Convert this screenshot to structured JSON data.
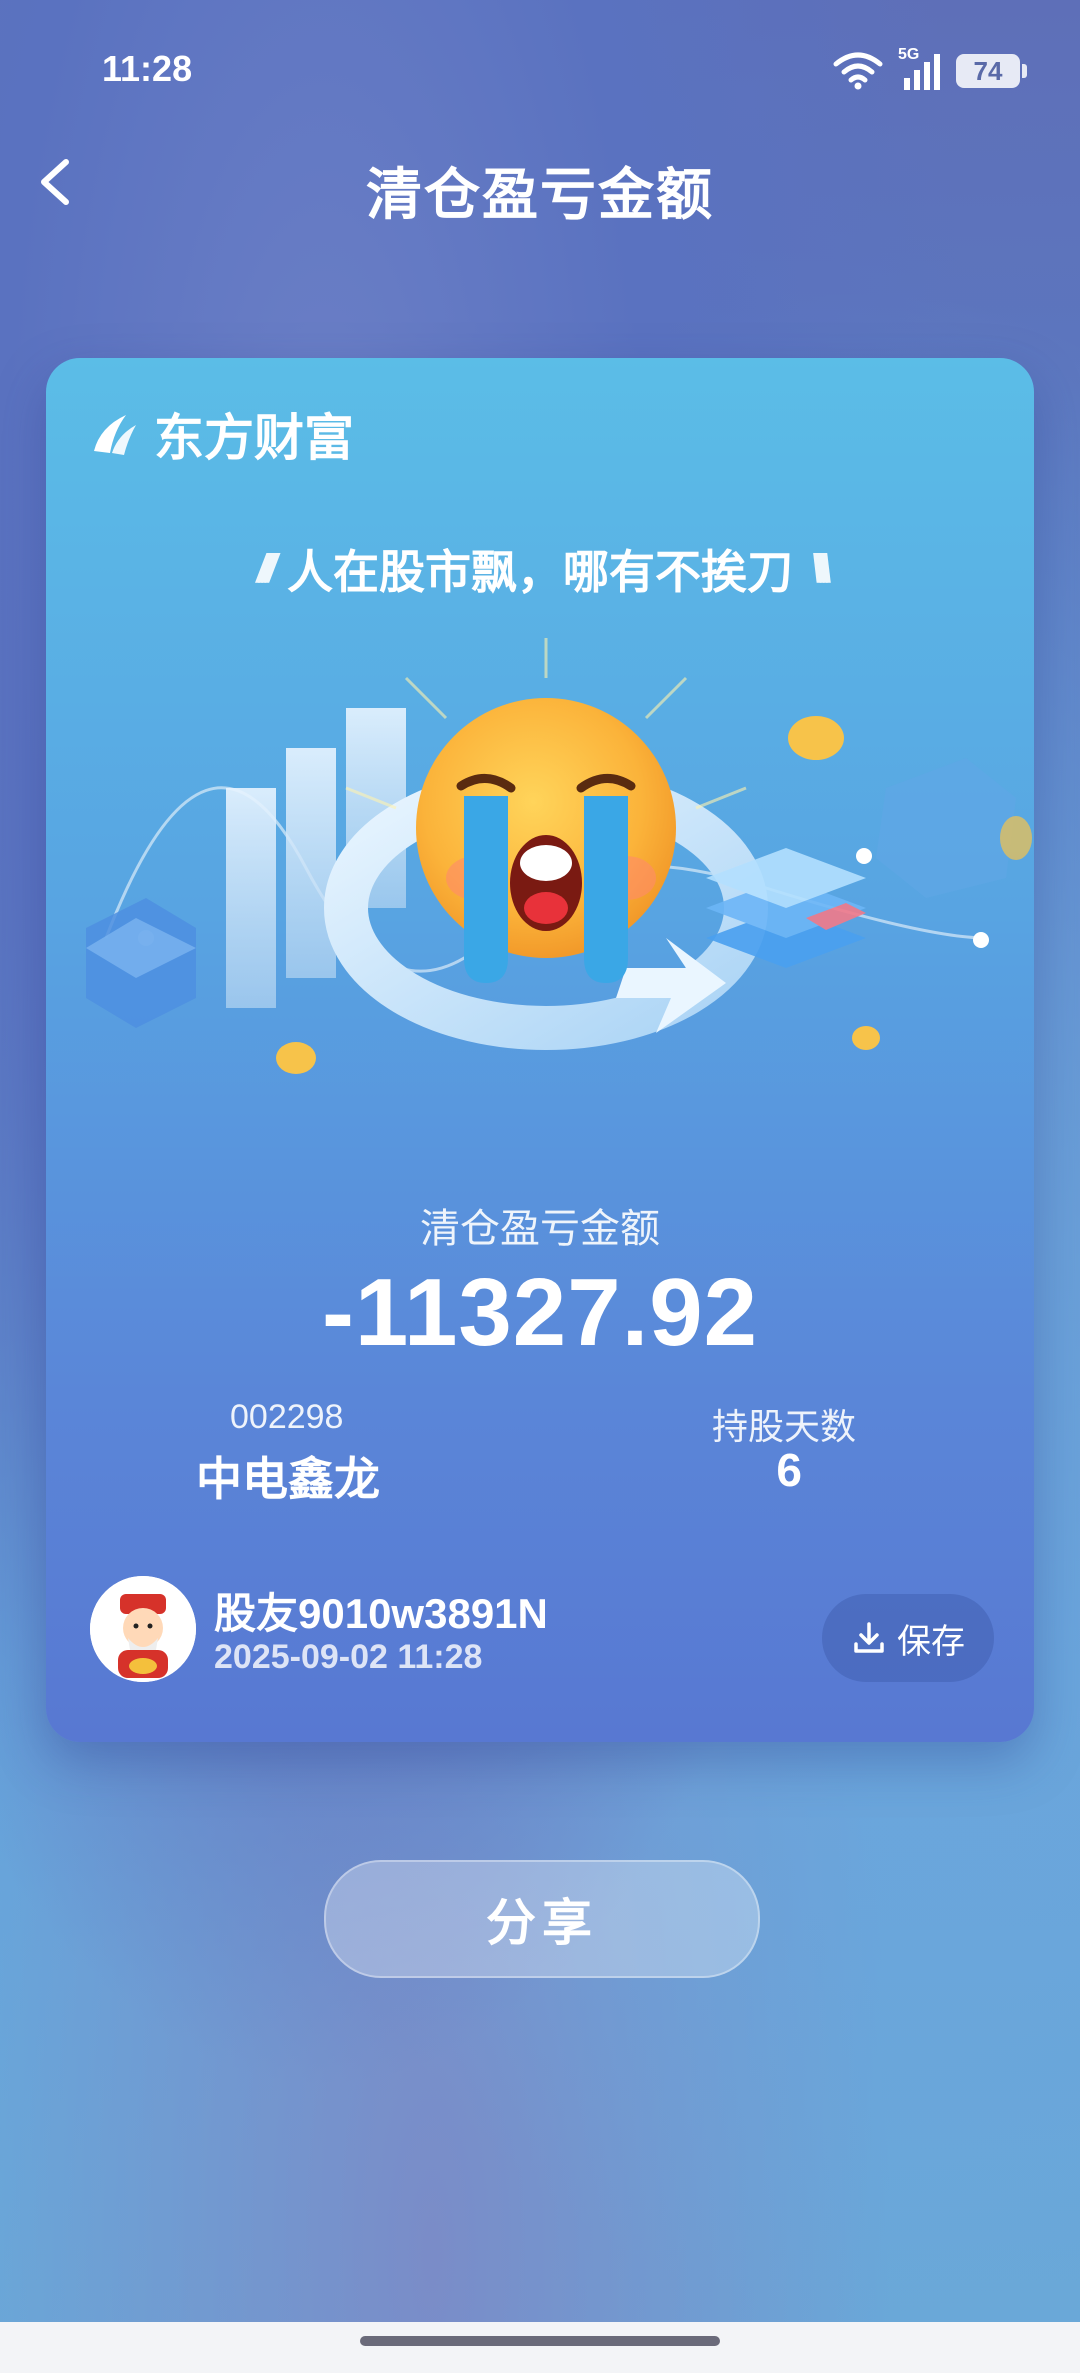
{
  "status_bar": {
    "time": "11:28",
    "network": "5G",
    "battery": "74"
  },
  "header": {
    "title": "清仓盈亏金额"
  },
  "card": {
    "brand": "东方财富",
    "slogan": "人在股市飘，哪有不挨刀",
    "amount_label": "清仓盈亏金额",
    "amount": "-11327.92",
    "stock_code": "002298",
    "stock_name": "中电鑫龙",
    "days_label": "持股天数",
    "days_value": "6",
    "user_name": "股友9010w3891N",
    "user_time": "2025-09-02 11:28",
    "save_label": "保存"
  },
  "share_label": "分享",
  "icons": [
    "back-arrow-icon",
    "wifi-icon",
    "signal-icon",
    "battery-icon",
    "brand-logo-icon",
    "crying-emoji-icon",
    "download-icon"
  ]
}
